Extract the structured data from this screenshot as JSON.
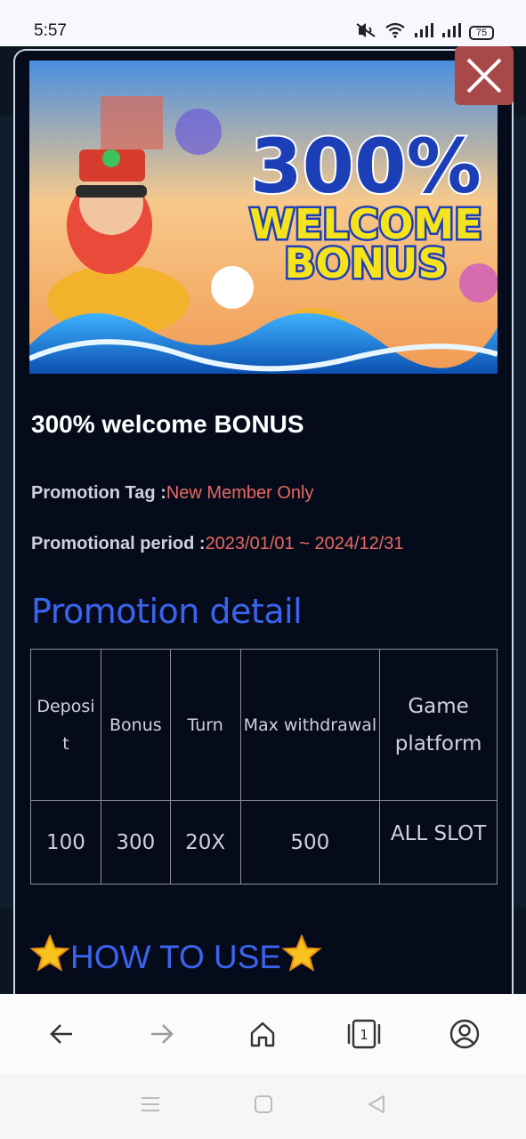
{
  "status_bar": {
    "time": "5:57",
    "battery": "75",
    "icons": [
      "mute-vibrate-icon",
      "wifi-icon",
      "signal-icon",
      "signal-icon",
      "battery-icon"
    ]
  },
  "modal": {
    "banner": {
      "headline_number": "300%",
      "headline_line1": "WELCOME",
      "headline_line2": "BONUS"
    },
    "close_icon": "close-icon",
    "title": "300% welcome BONUS",
    "promotion_tag_label": "Promotion Tag :",
    "promotion_tag_value": "New Member Only",
    "period_label": "Promotional period :",
    "period_value": "2023/01/01 ~ 2024/12/31",
    "detail_heading": "Promotion detail",
    "table": {
      "headers": [
        "Deposi\nt",
        "Bonus",
        "Turn",
        "Max withdrawal",
        "Game\nplatform"
      ],
      "rows": [
        [
          "100",
          "300",
          "20X",
          "500",
          "ALL SLOT"
        ]
      ]
    },
    "how_to_heading": "HOW TO USE",
    "star_icon": "star-emoji-icon"
  },
  "browser_bar": {
    "buttons": [
      "back-icon",
      "forward-icon",
      "home-icon",
      "tabs-icon",
      "profile-icon"
    ],
    "tab_count": "1"
  },
  "system_nav": [
    "menu-icon",
    "home-square-icon",
    "back-triangle-icon"
  ],
  "colors": {
    "modal_bg": "#060b1c",
    "accent_red": "#e86a60",
    "heading_blue": "#3a64ee",
    "close_bg": "#a94848"
  }
}
